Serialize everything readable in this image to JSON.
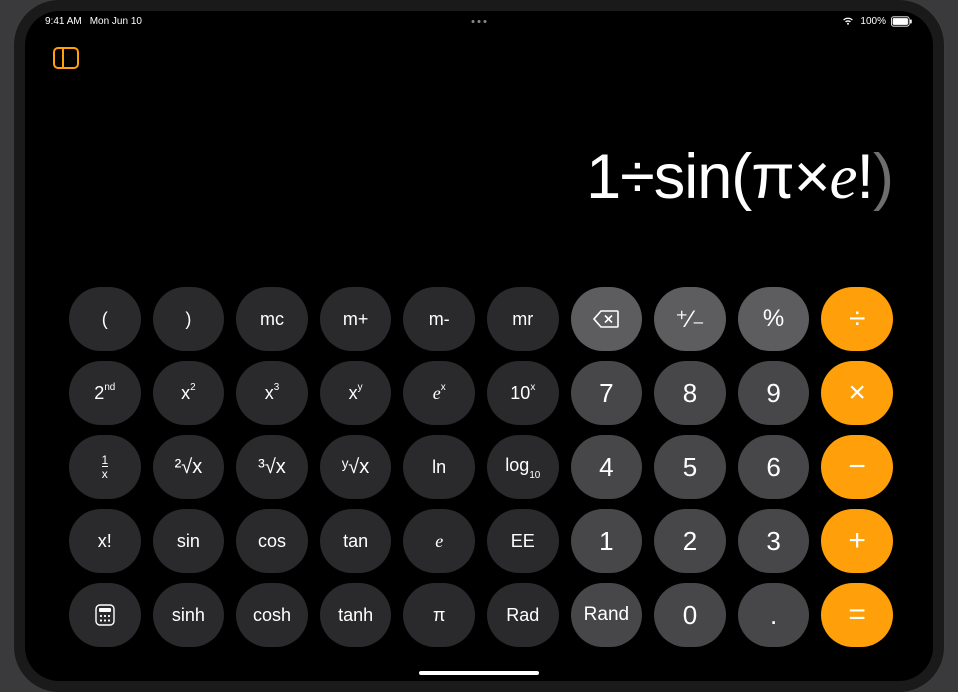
{
  "status": {
    "time": "9:41 AM",
    "date": "Mon Jun 10",
    "battery_text": "100%"
  },
  "display": {
    "expression_parts": {
      "p1": "1÷sin(π×",
      "e": "e",
      "bang": "!",
      "close": ")"
    }
  },
  "keys": {
    "lparen": "(",
    "rparen": ")",
    "mc": "mc",
    "mplus": "m+",
    "mminus": "m-",
    "mr": "mr",
    "plusminus": "⁺∕₋",
    "percent": "%",
    "divide": "÷",
    "second": "2",
    "second_sup": "nd",
    "xsq_base": "x",
    "xsq_sup": "2",
    "xcb_base": "x",
    "xcb_sup": "3",
    "xy_base": "x",
    "xy_sup": "y",
    "ex_base": "e",
    "ex_sup": "x",
    "tenx_base": "10",
    "tenx_sup": "x",
    "n7": "7",
    "n8": "8",
    "n9": "9",
    "multiply": "×",
    "inv_num": "1",
    "inv_den": "x",
    "sqrt": "²√x",
    "cbrt": "³√x",
    "yroot": "ʸ√x",
    "ln": "ln",
    "log10_base": "log",
    "log10_sub": "10",
    "n4": "4",
    "n5": "5",
    "n6": "6",
    "minus": "−",
    "xfact": "x!",
    "sin": "sin",
    "cos": "cos",
    "tan": "tan",
    "e": "e",
    "ee": "EE",
    "n1": "1",
    "n2": "2",
    "n3": "3",
    "plus": "+",
    "sinh": "sinh",
    "cosh": "cosh",
    "tanh": "tanh",
    "pi": "π",
    "rad": "Rad",
    "rand": "Rand",
    "n0": "0",
    "dot": ".",
    "equals": "="
  }
}
